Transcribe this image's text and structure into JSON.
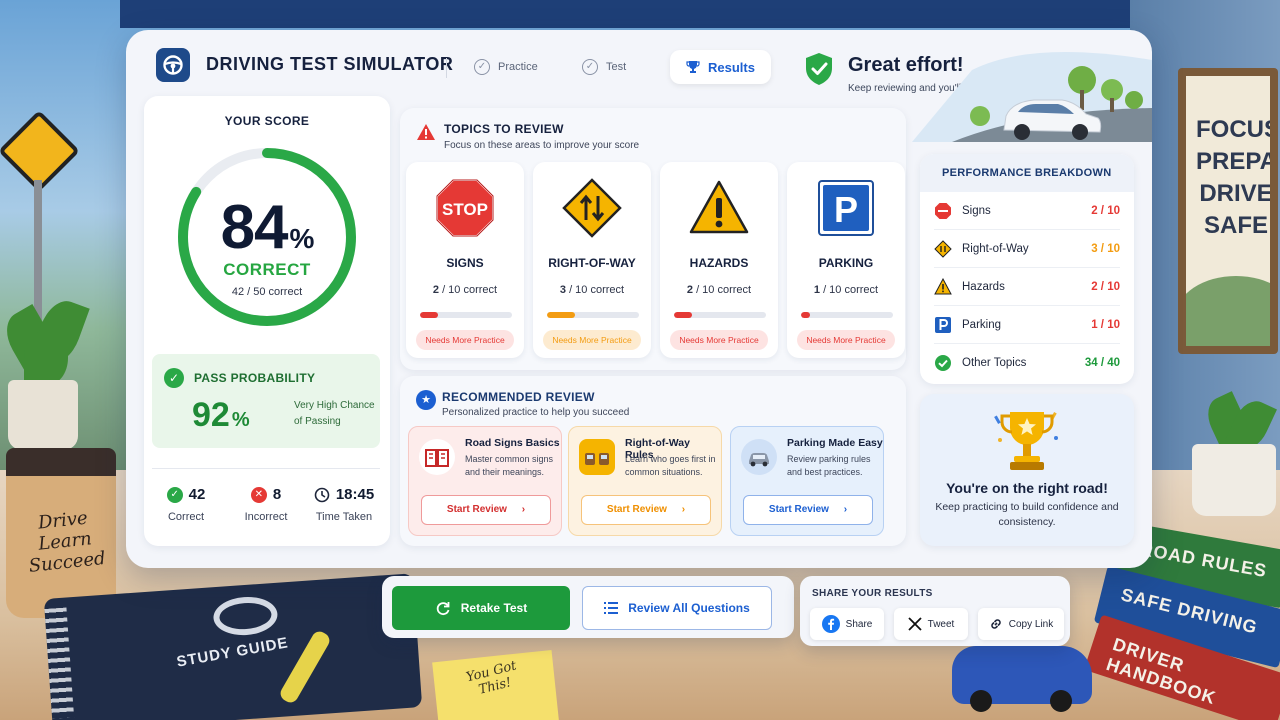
{
  "app": {
    "title": "DRIVING TEST SIMULATOR"
  },
  "steps": [
    {
      "label": "Practice"
    },
    {
      "label": "Test"
    },
    {
      "label": "Results"
    }
  ],
  "feedback": {
    "title": "Great effort!",
    "subtitle": "Keep reviewing and you'll be ready."
  },
  "score": {
    "title": "YOUR SCORE",
    "percent": "84",
    "percent_value": 84,
    "percent_sign": "%",
    "label": "CORRECT",
    "count": "42 / 50 correct"
  },
  "pass": {
    "label": "PASS PROBABILITY",
    "value": "92",
    "percent_sign": "%",
    "note": "Very High Chance of Passing"
  },
  "stats": [
    {
      "value": "42",
      "label": "Correct"
    },
    {
      "value": "8",
      "label": "Incorrect"
    },
    {
      "value": "18:45",
      "label": "Time Taken"
    }
  ],
  "topics": {
    "title": "TOPICS TO REVIEW",
    "subtitle": "Focus on these areas to improve your score",
    "items": [
      {
        "name": "SIGNS",
        "count": "2",
        "count_suffix": " / 10 correct",
        "progress": 0.2,
        "badge": "Needs More Practice",
        "color": "#e53935"
      },
      {
        "name": "RIGHT-OF-WAY",
        "count": "3",
        "count_suffix": " / 10 correct",
        "progress": 0.3,
        "badge": "Needs More Practice",
        "color": "#f39c12"
      },
      {
        "name": "HAZARDS",
        "count": "2",
        "count_suffix": " / 10 correct",
        "progress": 0.2,
        "badge": "Needs More Practice",
        "color": "#e53935"
      },
      {
        "name": "PARKING",
        "count": "1",
        "count_suffix": " / 10 correct",
        "progress": 0.1,
        "badge": "Needs More Practice",
        "color": "#e53935"
      }
    ],
    "sign_text": {
      "stop": "STOP",
      "parking": "P"
    }
  },
  "recommended": {
    "title": "RECOMMENDED REVIEW",
    "subtitle": "Personalized practice to help you succeed",
    "items": [
      {
        "title": "Road Signs Basics",
        "desc": "Master common signs and their meanings.",
        "button": "Start Review"
      },
      {
        "title": "Right-of-Way Rules",
        "desc": "Learn who goes first in common situations.",
        "button": "Start Review"
      },
      {
        "title": "Parking Made Easy",
        "desc": "Review parking rules and best practices.",
        "button": "Start Review"
      }
    ]
  },
  "breakdown": {
    "title": "PERFORMANCE BREAKDOWN",
    "rows": [
      {
        "name": "Signs",
        "value": "2 / 10",
        "color": "#e53935"
      },
      {
        "name": "Right-of-Way",
        "value": "3 / 10",
        "color": "#f39c12"
      },
      {
        "name": "Hazards",
        "value": "2 / 10",
        "color": "#e53935"
      },
      {
        "name": "Parking",
        "value": "1 / 10",
        "color": "#e53935"
      },
      {
        "name": "Other Topics",
        "value": "34 / 40",
        "color": "#1e9a3c"
      }
    ]
  },
  "trophy": {
    "title": "You're on the right road!",
    "subtitle": "Keep practicing to build confidence and consistency."
  },
  "actions": {
    "retake": "Retake Test",
    "review_all": "Review All Questions"
  },
  "share": {
    "title": "SHARE YOUR RESULTS",
    "buttons": [
      {
        "label": "Share"
      },
      {
        "label": "Tweet"
      },
      {
        "label": "Copy Link"
      }
    ]
  },
  "scene": {
    "cup_text": "Drive Learn Succeed",
    "notebook_title": "STUDY GUIDE",
    "sticky_text": "You Got This!",
    "poster_text": "FOCUS PREPARE DRIVE SAFE",
    "books": [
      "ROAD RULES",
      "SAFE DRIVING",
      "DRIVER HANDBOOK"
    ]
  },
  "colors": {
    "primary": "#1c5fd1",
    "success": "#1e9a3c",
    "danger": "#e53935",
    "warning": "#f39c12"
  },
  "icons": {
    "logo": "steering-wheel-icon",
    "check": "check-circle-icon",
    "results": "trophy-icon",
    "shield": "shield-check-icon",
    "warning": "warning-triangle-icon",
    "star": "star-badge-icon",
    "retake": "refresh-icon",
    "review": "list-icon",
    "facebook": "facebook-icon",
    "twitter": "x-icon",
    "link": "link-icon"
  }
}
